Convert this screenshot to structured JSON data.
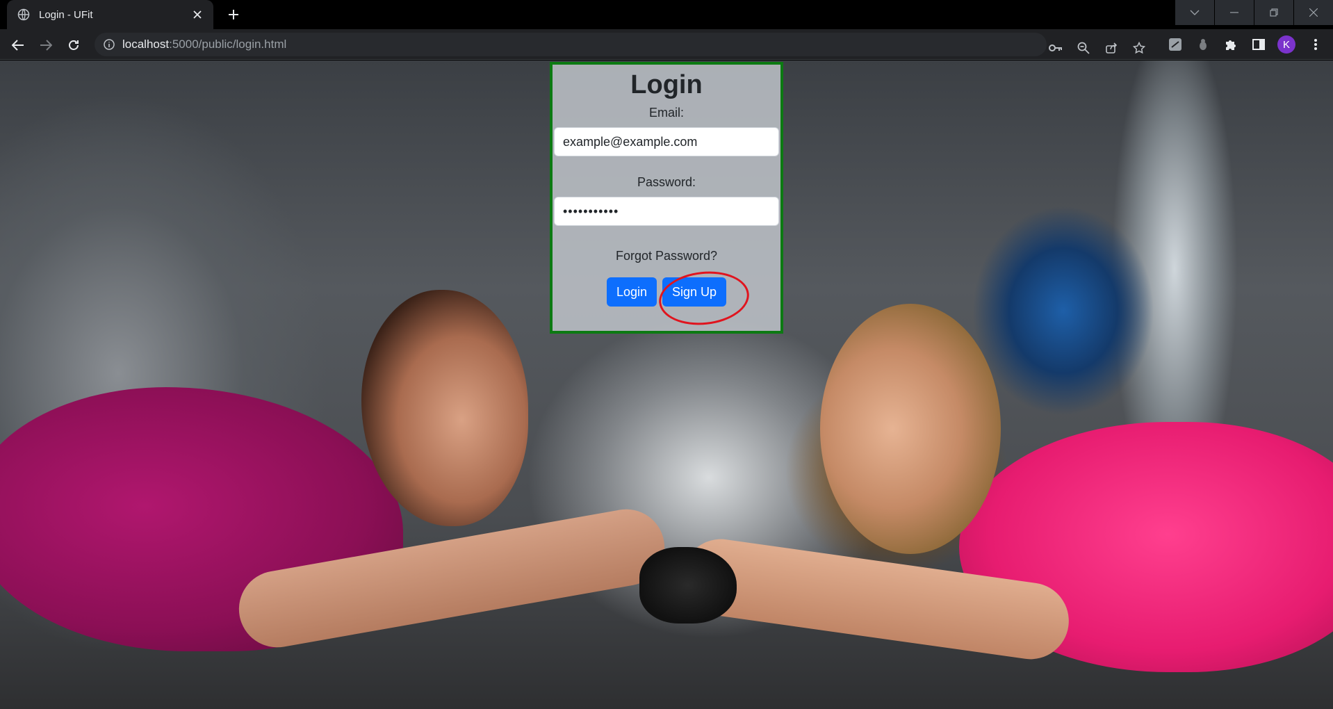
{
  "browser": {
    "tab_title": "Login - UFit",
    "url_host": "localhost",
    "url_rest": ":5000/public/login.html",
    "profile_initial": "K",
    "icons": [
      "globe-icon",
      "close-icon",
      "plus-icon",
      "back-icon",
      "forward-icon",
      "reload-icon",
      "info-icon",
      "key-icon",
      "zoom-icon",
      "share-icon",
      "star-icon",
      "extension-icon",
      "puzzle-icon",
      "sidebar-icon",
      "menu-icon"
    ]
  },
  "login": {
    "title": "Login",
    "email_label": "Email:",
    "email_value": "example@example.com",
    "password_label": "Password:",
    "password_value": "•••••••••••",
    "forgot_label": "Forgot Password?",
    "login_button": "Login",
    "signup_button": "Sign Up"
  },
  "colors": {
    "card_border": "#0c7a12",
    "button": "#0d6efd",
    "annotation": "#e0141e",
    "avatar": "#7b33cc"
  }
}
